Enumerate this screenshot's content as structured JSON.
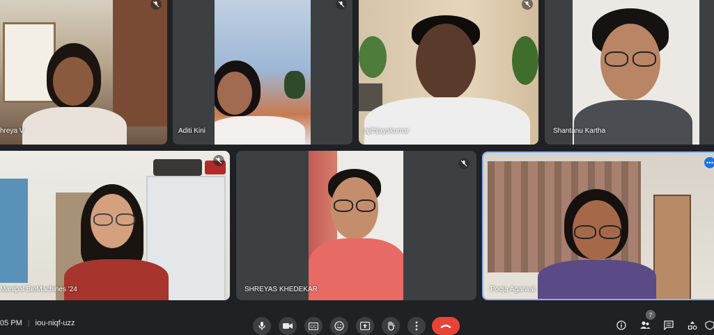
{
  "participants": [
    {
      "name": "hreya V",
      "muted": true
    },
    {
      "name": "Aditi Kini",
      "muted": true
    },
    {
      "name": "ajithjayakumar",
      "muted": true
    },
    {
      "name": "Shantanu Kartha",
      "muted": false
    },
    {
      "name": "Manipal BioMachines '24",
      "muted": true
    },
    {
      "name": "SHREYAS KHEDEKAR",
      "muted": true
    },
    {
      "name": "Pooja Agarwal",
      "muted": false,
      "active_speaker": true
    }
  ],
  "meeting": {
    "time": "05 PM",
    "separator": "|",
    "code": "iou-niqf-uzz"
  },
  "controls": [
    "microphone-icon",
    "camera-icon",
    "captions-icon",
    "emoji-icon",
    "present-icon",
    "raise-hand-icon",
    "more-options-icon",
    "end-call-icon"
  ],
  "right_controls": {
    "people_count": "7",
    "icons": [
      "info-icon",
      "people-icon",
      "chat-icon",
      "activities-icon",
      "host-controls-icon"
    ]
  },
  "colors": {
    "background": "#202124",
    "tile": "#3c4043",
    "active_border": "#8ab4f8",
    "end_call": "#ea4335"
  }
}
